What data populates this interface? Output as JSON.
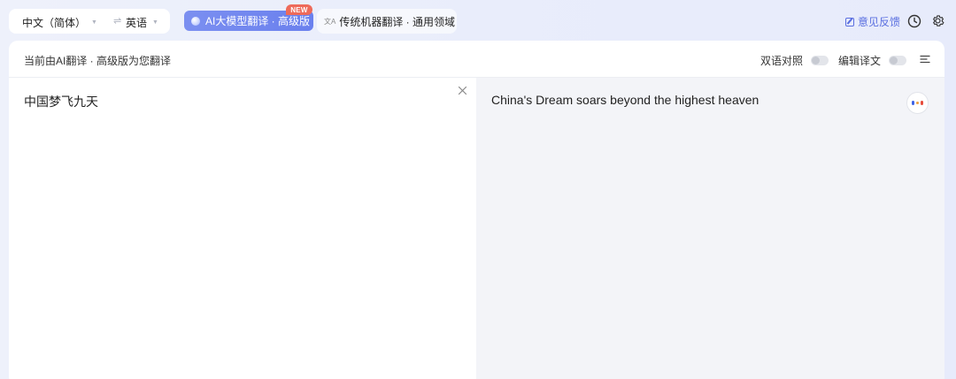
{
  "topbar": {
    "source_lang": "中文（简体）",
    "target_lang": "英语",
    "swap_icon": "⇌",
    "ai_mode_label": "AI大模型翻译 · 高级版",
    "new_badge": "NEW",
    "mt_mode_label": "传统机器翻译 · 通用领域",
    "feedback_label": "意见反馈"
  },
  "panel": {
    "status_text": "当前由AI翻译 · 高级版为您翻译",
    "bilingual_label": "双语对照",
    "bilingual_on": false,
    "edit_label": "编辑译文",
    "edit_on": false
  },
  "source": {
    "text": "中国梦飞九天"
  },
  "target": {
    "text": "China's Dream soars beyond the highest heaven"
  },
  "colors": {
    "accent": "#6a80ee",
    "badge": "#ee6a5a",
    "target_bg": "#f3f4f8"
  }
}
